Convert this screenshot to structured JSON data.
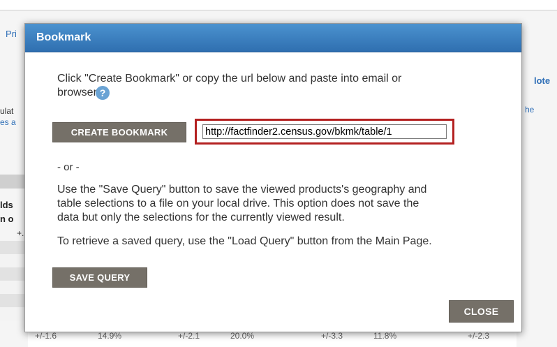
{
  "background": {
    "left_fragments": [
      "Pri",
      "ulat",
      "es a",
      "lds",
      "n o",
      "+."
    ],
    "right_fragments": [
      "lote",
      "he"
    ],
    "bottom_cells": [
      "+/-1.6",
      "14.9%",
      "+/-2.1",
      "20.0%",
      "+/-3.3",
      "11.8%",
      "+/-2.3"
    ]
  },
  "modal": {
    "title": "Bookmark",
    "intro_line1": "Click \"Create Bookmark\" or copy the url below and paste into email or",
    "intro_line2": "browser.",
    "help_icon_glyph": "?",
    "create_bookmark_label": "CREATE BOOKMARK",
    "url_value": "http://factfinder2.census.gov/bkmk/table/1",
    "or_text": "- or -",
    "save_query_line1": "Use the \"Save Query\" button to save the viewed products's geography and",
    "save_query_line2": "table selections to a file on your local drive. This option does not save the",
    "save_query_line3": "data but only the selections for the currently viewed result.",
    "load_query_text": "To retrieve a saved query, use the \"Load Query\" button from the Main Page.",
    "save_query_label": "SAVE QUERY",
    "close_label": "CLOSE"
  },
  "colors": {
    "header_blue": "#3a7dbf",
    "button_gray": "#757068",
    "url_highlight": "#b42121"
  }
}
